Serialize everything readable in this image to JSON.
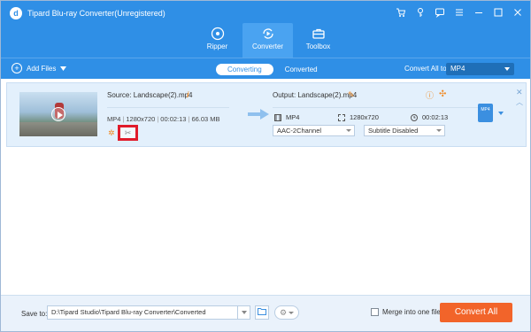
{
  "window": {
    "title": "Tipard Blu-ray Converter(Unregistered)",
    "logo_glyph": "d",
    "controls": [
      "cart-icon",
      "key-icon",
      "chat-icon",
      "menu-icon",
      "minimize-icon",
      "maximize-icon",
      "close-icon"
    ]
  },
  "nav": {
    "items": [
      {
        "label": "Ripper",
        "icon": "disc-icon",
        "active": false
      },
      {
        "label": "Converter",
        "icon": "convert-icon",
        "active": true
      },
      {
        "label": "Toolbox",
        "icon": "toolbox-icon",
        "active": false
      }
    ]
  },
  "toolbar": {
    "add_files": "Add Files",
    "tabs": [
      "Converting",
      "Converted"
    ],
    "active_tab": "Converting",
    "convert_all_to_label": "Convert All to:",
    "format_value": "MP4"
  },
  "file": {
    "source_label": "Source: Landscape(2).mp4",
    "meta": [
      "MP4",
      "1280x720",
      "00:02:13",
      "66.03 MB"
    ],
    "output_label": "Output: Landscape(2).mp4",
    "out_format": "MP4",
    "out_resolution": "1280x720",
    "out_duration": "00:02:13",
    "audio_track": "AAC-2Channel",
    "subtitle": "Subtitle Disabled",
    "badge": "MP4"
  },
  "bottom": {
    "save_to_label": "Save to:",
    "path": "D:\\Tipard Studio\\Tipard Blu-ray Converter\\Converted",
    "merge_label": "Merge into one file",
    "convert_all": "Convert All"
  },
  "colors": {
    "brand_blue": "#2f8fe6",
    "accent_orange": "#f2642a",
    "highlight_red": "#e01b2b"
  }
}
